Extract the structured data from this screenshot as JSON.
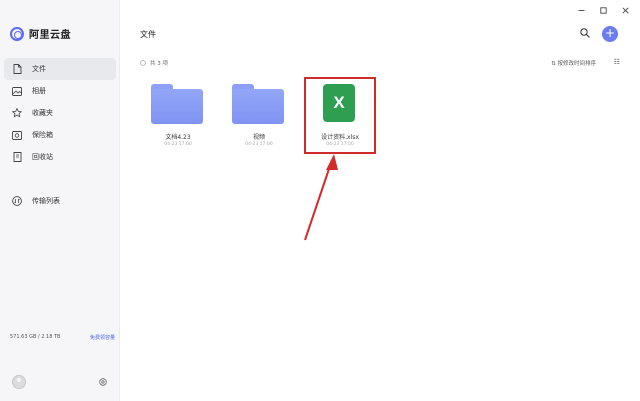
{
  "app": {
    "brand_name": "阿里云盘",
    "brand_color": "#5b6cf5"
  },
  "sidebar": {
    "items": [
      {
        "label": "文件",
        "icon": "file-icon",
        "active": true
      },
      {
        "label": "相册",
        "icon": "photo-icon",
        "active": false
      },
      {
        "label": "收藏夹",
        "icon": "star-icon",
        "active": false
      },
      {
        "label": "保险箱",
        "icon": "safe-icon",
        "active": false
      },
      {
        "label": "回收站",
        "icon": "trash-icon",
        "active": false
      }
    ],
    "transfer_label": "传输列表",
    "storage_text": "571.63 GB / 2.18 TB",
    "upgrade_label": "免费领容量"
  },
  "main": {
    "title": "文件",
    "item_count": "共 3 项",
    "sort_label": "按修改时间排序",
    "files": [
      {
        "name": "文档4.23",
        "date": "04-23 17:00",
        "type": "folder"
      },
      {
        "name": "视频",
        "date": "04-23 17:00",
        "type": "folder"
      },
      {
        "name": "设计资料.xlsx",
        "date": "04-23 17:00",
        "type": "excel",
        "icon_letter": "X"
      }
    ]
  },
  "colors": {
    "folder": "#8b9ef6",
    "excel": "#2e9e51",
    "highlight": "#d12c2c",
    "add_button": "#6b7cf0"
  }
}
